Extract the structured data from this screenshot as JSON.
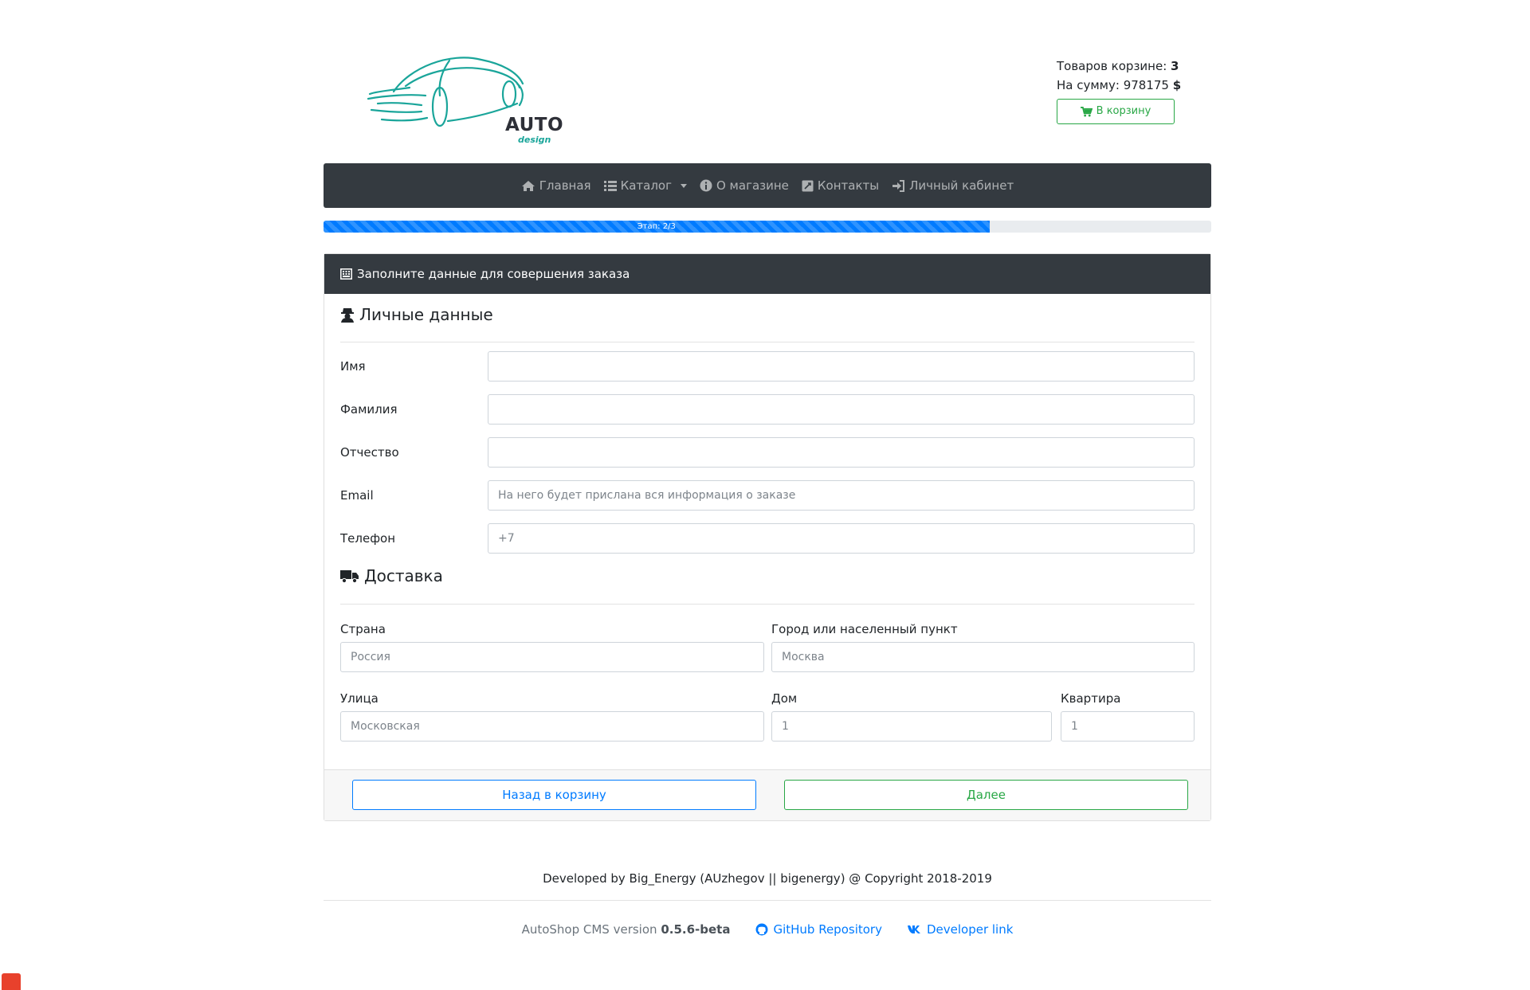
{
  "colors": {
    "accent": "#007bff",
    "success": "#28a745",
    "dark": "#343a40",
    "logo": "#1aa59a"
  },
  "logo": {
    "word": "AUTO",
    "sub": "design"
  },
  "cart": {
    "items_label": "Товаров корзине:",
    "items_count": "3",
    "sum_label": "На сумму:",
    "sum_value": "978175",
    "currency": "$",
    "button_label": "В корзину",
    "button_icon": "shopping-cart-icon"
  },
  "nav": {
    "items": [
      {
        "label": "Главная",
        "icon": "home-icon"
      },
      {
        "label": "Каталог",
        "icon": "list-icon"
      },
      {
        "label": "О магазине",
        "icon": "info-icon"
      },
      {
        "label": "Контакты",
        "icon": "contacts-icon"
      },
      {
        "label": "Личный кабинет",
        "icon": "sign-in-icon"
      }
    ]
  },
  "progress": {
    "label": "Этап: 2/3",
    "value": 0.75
  },
  "form": {
    "header": "Заполните данные для совершения заказа",
    "personal": {
      "title": "Личные данные",
      "fields": [
        {
          "label": "Имя",
          "value": "",
          "placeholder": ""
        },
        {
          "label": "Фамилия",
          "value": "",
          "placeholder": ""
        },
        {
          "label": "Отчество",
          "value": "",
          "placeholder": ""
        },
        {
          "label": "Email",
          "value": "",
          "placeholder": "На него будет прислана вся информация о заказе"
        },
        {
          "label": "Телефон",
          "value": "",
          "placeholder": "+7"
        }
      ]
    },
    "delivery": {
      "title": "Доставка",
      "country": {
        "label": "Страна",
        "placeholder": "Россия"
      },
      "city": {
        "label": "Город или населенный пункт",
        "placeholder": "Москва"
      },
      "street": {
        "label": "Улица",
        "placeholder": "Московская"
      },
      "house": {
        "label": "Дом",
        "placeholder": "1"
      },
      "apartment": {
        "label": "Квартира",
        "placeholder": "1"
      }
    },
    "back_label": "Назад в корзину",
    "next_label": "Далее"
  },
  "footer": {
    "copyright": "Developed by Big_Energy (AUzhegov || bigenergy) @ Copyright 2018-2019",
    "version_label": "AutoShop CMS version",
    "version": "0.5.6-beta",
    "github_label": "GitHub Repository",
    "developer_label": "Developer link"
  }
}
